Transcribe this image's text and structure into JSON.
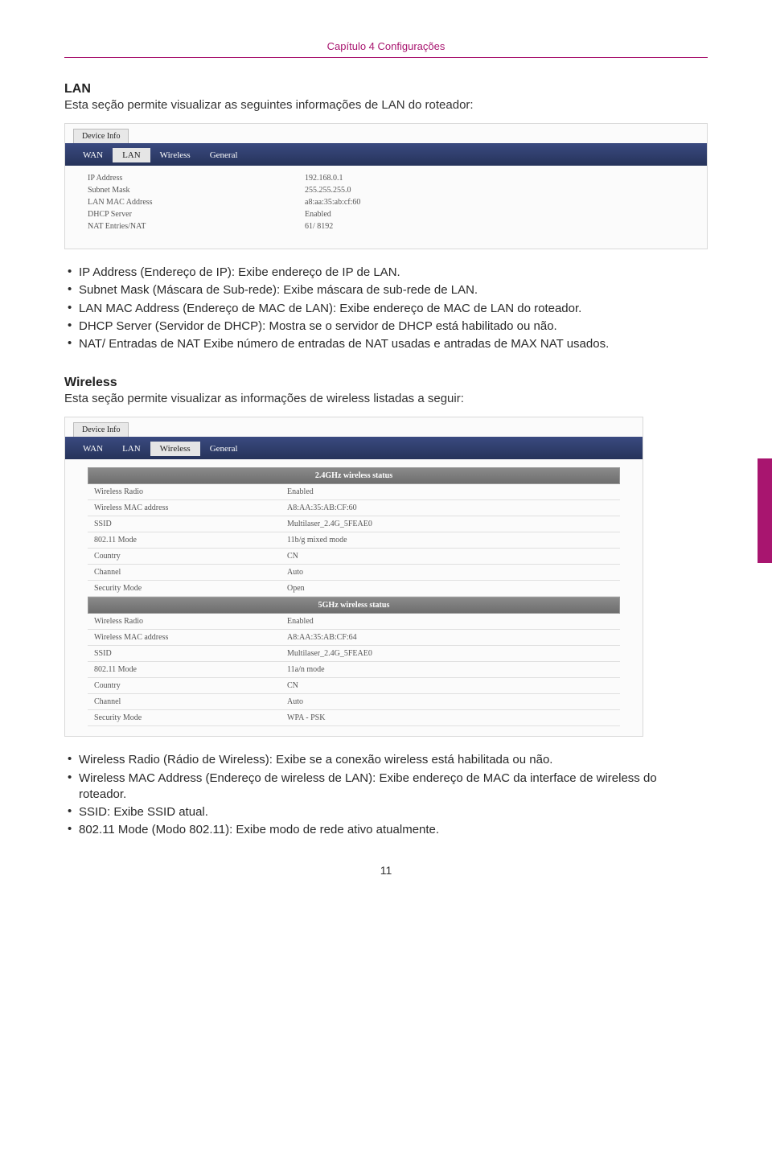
{
  "chapter_header": "Capítulo 4 Configurações",
  "lan": {
    "heading": "LAN",
    "intro": "Esta seção permite visualizar as seguintes informações de LAN do roteador:",
    "device_info_label": "Device Info",
    "tabs": {
      "wan": "WAN",
      "lan": "LAN",
      "wireless": "Wireless",
      "general": "General"
    },
    "rows": [
      {
        "label": "IP Address",
        "value": "192.168.0.1"
      },
      {
        "label": "Subnet Mask",
        "value": "255.255.255.0"
      },
      {
        "label": "LAN MAC Address",
        "value": "a8:aa:35:ab:cf:60"
      },
      {
        "label": "DHCP Server",
        "value": "Enabled"
      },
      {
        "label": "NAT Entries/NAT",
        "value": "61/ 8192"
      }
    ],
    "bullets": [
      "IP Address (Endereço de IP): Exibe endereço de IP de LAN.",
      "Subnet Mask (Máscara de Sub-rede): Exibe máscara de sub-rede de LAN.",
      "LAN MAC Address (Endereço de MAC de LAN): Exibe endereço de MAC de LAN do roteador.",
      "DHCP Server (Servidor de DHCP): Mostra se o servidor de DHCP está habilitado ou não.",
      "NAT/ Entradas de NAT Exibe número de entradas de NAT usadas e antradas de MAX NAT usados."
    ]
  },
  "wireless": {
    "heading": "Wireless",
    "intro": "Esta seção permite visualizar as informações de wireless listadas a seguir:",
    "device_info_label": "Device Info",
    "tabs": {
      "wan": "WAN",
      "lan": "LAN",
      "wireless": "Wireless",
      "general": "General"
    },
    "section24_title": "2.4GHz wireless status",
    "rows24": [
      {
        "label": "Wireless Radio",
        "value": "Enabled"
      },
      {
        "label": "Wireless MAC address",
        "value": "A8:AA:35:AB:CF:60"
      },
      {
        "label": "SSID",
        "value": "Multilaser_2.4G_5FEAE0"
      },
      {
        "label": "802.11 Mode",
        "value": "11b/g mixed mode"
      },
      {
        "label": "Country",
        "value": "CN"
      },
      {
        "label": "Channel",
        "value": "Auto"
      },
      {
        "label": "Security Mode",
        "value": "Open"
      }
    ],
    "section5_title": "5GHz wireless status",
    "rows5": [
      {
        "label": "Wireless Radio",
        "value": "Enabled"
      },
      {
        "label": "Wireless MAC address",
        "value": "A8:AA:35:AB:CF:64"
      },
      {
        "label": "SSID",
        "value": "Multilaser_2.4G_5FEAE0"
      },
      {
        "label": "802.11 Mode",
        "value": "11a/n mode"
      },
      {
        "label": "Country",
        "value": "CN"
      },
      {
        "label": "Channel",
        "value": "Auto"
      },
      {
        "label": "Security Mode",
        "value": "WPA - PSK"
      }
    ],
    "bullets": [
      "Wireless Radio (Rádio de Wireless): Exibe se a conexão wireless está habilitada ou não.",
      "Wireless MAC Address (Endereço de wireless de LAN): Exibe endereço de MAC da interface de wireless do roteador.",
      "SSID: Exibe SSID atual.",
      "802.11 Mode (Modo 802.11): Exibe modo de rede ativo atualmente."
    ]
  },
  "page_number": "11"
}
